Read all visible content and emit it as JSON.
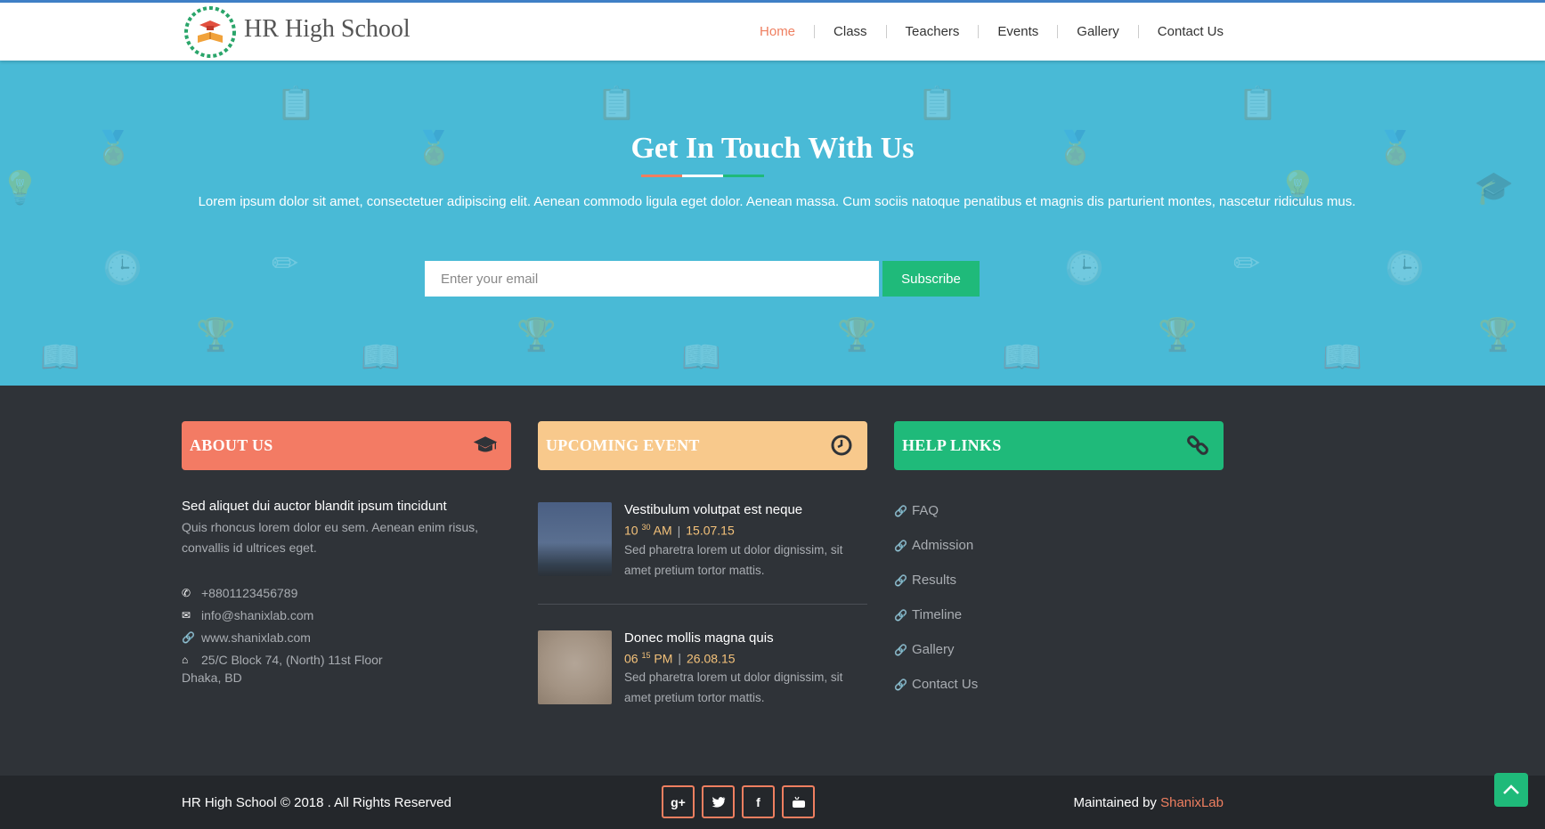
{
  "header": {
    "brand": "HR High School",
    "nav": [
      "Home",
      "Class",
      "Teachers",
      "Events",
      "Gallery",
      "Contact Us"
    ],
    "active": "Home"
  },
  "hero": {
    "title": "Get In Touch With Us",
    "text": "Lorem ipsum dolor sit amet, consectetuer adipiscing elit. Aenean commodo ligula eget dolor. Aenean massa. Cum sociis natoque penatibus et magnis dis parturient montes, nascetur ridiculus mus.",
    "email_placeholder": "Enter your email",
    "subscribe_label": "Subscribe",
    "underline_colors": [
      "#ef7f60",
      "#ffffff",
      "#1fba7a"
    ]
  },
  "about": {
    "heading": "ABOUT US",
    "title": "Sed aliquet dui auctor blandit ipsum tincidunt",
    "text": "Quis rhoncus lorem dolor eu sem. Aenean enim risus, convallis id ultrices eget.",
    "phone": "+8801123456789",
    "email": "info@shanixlab.com",
    "web": "www.shanixlab.com",
    "address": "25/C Block 74, (North) 11st Floor",
    "address2": "Dhaka, BD",
    "color": "#f37b64"
  },
  "events": {
    "heading": "UPCOMING EVENT",
    "color": "#f8c98c",
    "items": [
      {
        "title": "Vestibulum volutpat est neque",
        "hour": "10",
        "min": "30",
        "ampm": "AM",
        "date": "15.07.15",
        "desc": "Sed pharetra lorem ut dolor dignissim, sit amet pretium tortor mattis."
      },
      {
        "title": "Donec mollis magna quis",
        "hour": "06",
        "min": "15",
        "ampm": "PM",
        "date": "26.08.15",
        "desc": "Sed pharetra lorem ut dolor dignissim, sit amet pretium tortor mattis."
      }
    ]
  },
  "help": {
    "heading": "HELP LINKS",
    "color": "#1fba7a",
    "links": [
      "FAQ",
      "Admission",
      "Results",
      "Timeline",
      "Gallery",
      "Contact Us"
    ]
  },
  "footer": {
    "copyright": "HR High School © 2018 . All Rights Reserved",
    "maintained_prefix": "Maintained by ",
    "maintained_by": "ShanixLab",
    "social": [
      "g+",
      "twitter",
      "facebook",
      "youtube"
    ]
  }
}
